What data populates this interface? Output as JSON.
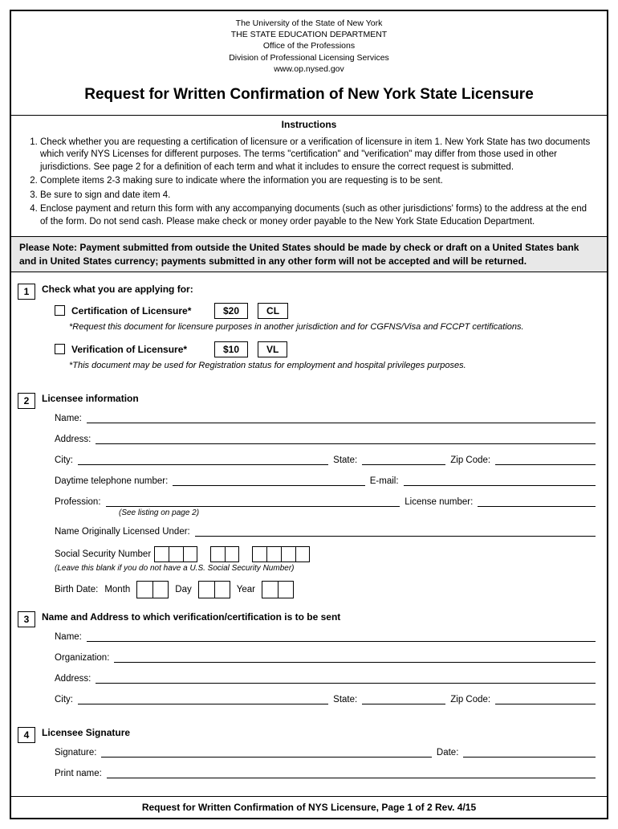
{
  "header": {
    "line1": "The University of the State of New York",
    "line2": "THE STATE EDUCATION DEPARTMENT",
    "line3": "Office of the Professions",
    "line4": "Division of Professional Licensing Services",
    "url": "www.op.nysed.gov"
  },
  "title": "Request for Written Confirmation of New York State Licensure",
  "instructions": {
    "heading": "Instructions",
    "items": [
      "Check whether you are requesting a certification of licensure or a verification of licensure in item 1. New York State has two documents which verify NYS Licenses for different purposes. The terms \"certification\" and \"verification\" may differ from those used in other jurisdictions. See page 2 for a definition of each term and what it includes to ensure the correct request is submitted.",
      "Complete items 2-3 making sure to indicate where the information you are requesting is to be sent.",
      "Be sure to sign and date item 4.",
      "Enclose payment and return this form with any accompanying documents (such as other jurisdictions' forms) to the address at the end of the form. Do not send cash. Please make check or money order payable to the New York State Education Department."
    ]
  },
  "note": "Please Note: Payment submitted from outside the United States should be made by check or draft on a United States bank and in United States currency; payments submitted in any other form will not be accepted and will be returned.",
  "sections": {
    "s1": {
      "num": "1",
      "title": "Check what you are applying for:",
      "opt1": {
        "label": "Certification of Licensure*",
        "price": "$20",
        "code": "CL",
        "desc": "*Request this document for licensure purposes in another jurisdiction and for CGFNS/Visa and FCCPT certifications."
      },
      "opt2": {
        "label": "Verification of Licensure*",
        "price": "$10",
        "code": "VL",
        "desc": "*This document may be used for Registration status for employment and hospital privileges purposes."
      }
    },
    "s2": {
      "num": "2",
      "title": "Licensee information",
      "labels": {
        "name": "Name:",
        "address": "Address:",
        "city": "City:",
        "state": "State:",
        "zip": "Zip Code:",
        "phone": "Daytime telephone number:",
        "email": "E-mail:",
        "profession": "Profession:",
        "profession_sub": "(See listing on page 2)",
        "license": "License number:",
        "orig_name": "Name Originally Licensed Under:",
        "ssn": "Social Security Number",
        "ssn_note": "(Leave this blank if you do not have a U.S. Social Security Number)",
        "birth": "Birth Date:",
        "month": "Month",
        "day": "Day",
        "year": "Year"
      }
    },
    "s3": {
      "num": "3",
      "title": "Name and Address to which verification/certification is to be sent",
      "labels": {
        "name": "Name:",
        "org": "Organization:",
        "address": "Address:",
        "city": "City:",
        "state": "State:",
        "zip": "Zip Code:"
      }
    },
    "s4": {
      "num": "4",
      "title": "Licensee Signature",
      "labels": {
        "sig": "Signature:",
        "date": "Date:",
        "print": "Print name:"
      }
    }
  },
  "footer": "Request for Written Confirmation of NYS Licensure, Page 1 of 2 Rev. 4/15"
}
